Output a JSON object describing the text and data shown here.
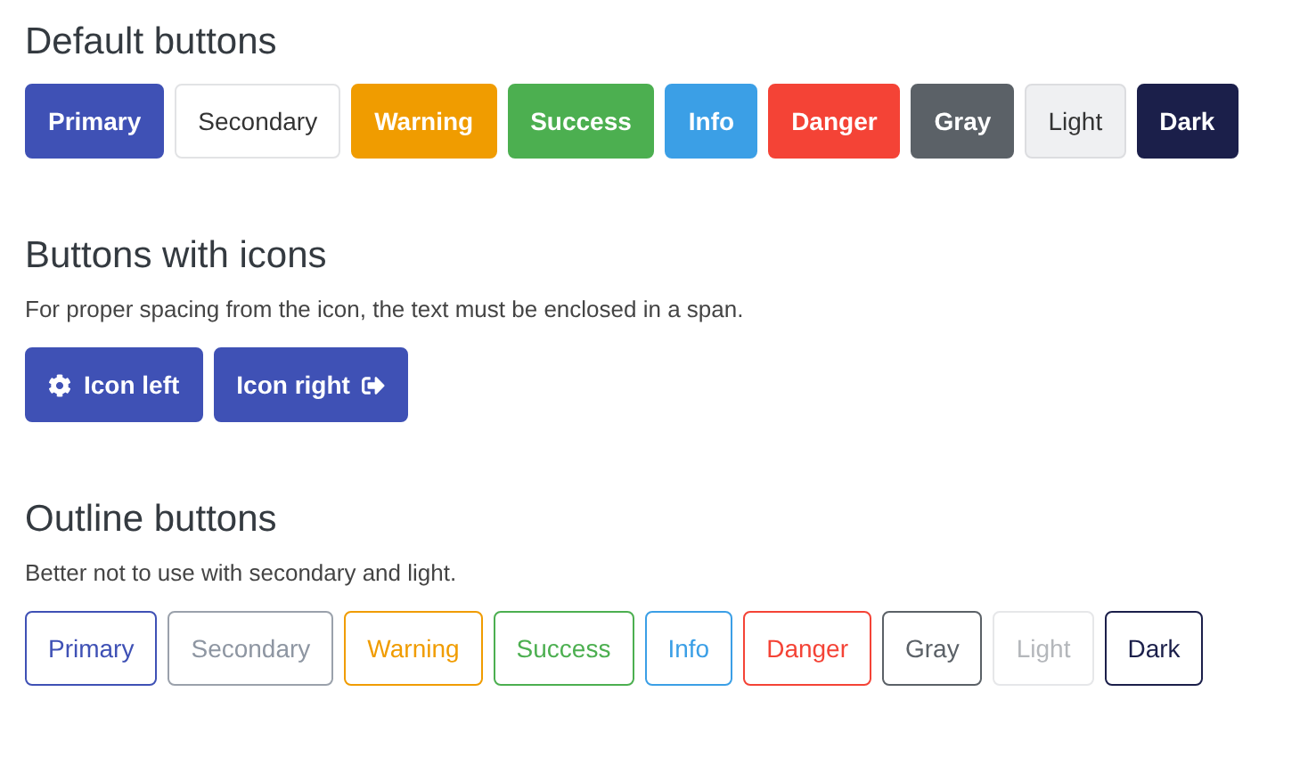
{
  "sections": [
    {
      "title": "Default buttons",
      "kind": "solid",
      "buttons": [
        {
          "label": "Primary",
          "kind": "primary"
        },
        {
          "label": "Secondary",
          "kind": "secondary"
        },
        {
          "label": "Warning",
          "kind": "warning"
        },
        {
          "label": "Success",
          "kind": "success"
        },
        {
          "label": "Info",
          "kind": "info"
        },
        {
          "label": "Danger",
          "kind": "danger"
        },
        {
          "label": "Gray",
          "kind": "gray"
        },
        {
          "label": "Light",
          "kind": "light"
        },
        {
          "label": "Dark",
          "kind": "dark"
        }
      ]
    },
    {
      "title": "Buttons with icons",
      "description": "For proper spacing from the icon, the text must be enclosed in a span.",
      "kind": "solid",
      "buttons": [
        {
          "label": "Icon left",
          "kind": "iconleft"
        },
        {
          "label": "Icon right",
          "kind": "iconright"
        }
      ]
    },
    {
      "title": "Outline buttons",
      "description": "Better not to use with secondary and light.",
      "kind": "outline",
      "buttons": [
        {
          "label": "Primary",
          "kind": "primary"
        },
        {
          "label": "Secondary",
          "kind": "secondary"
        },
        {
          "label": "Warning",
          "kind": "warning"
        },
        {
          "label": "Success",
          "kind": "success"
        },
        {
          "label": "Info",
          "kind": "info"
        },
        {
          "label": "Danger",
          "kind": "danger"
        },
        {
          "label": "Gray",
          "kind": "gray"
        },
        {
          "label": "Light",
          "kind": "light"
        },
        {
          "label": "Dark",
          "kind": "dark"
        }
      ]
    }
  ]
}
